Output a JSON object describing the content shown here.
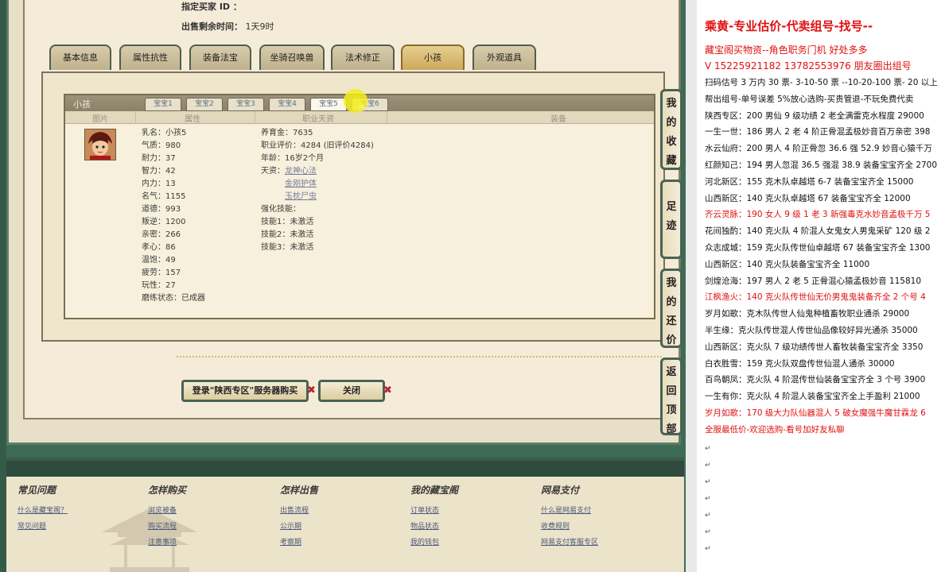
{
  "header": {
    "buyer_label": "指定买家 ID ：",
    "remaining_label": "出售剩余时间：",
    "remaining_value": "1天9时"
  },
  "tabs": [
    {
      "label": "基本信息"
    },
    {
      "label": "属性抗性"
    },
    {
      "label": "装备法宝"
    },
    {
      "label": "坐骑召唤兽"
    },
    {
      "label": "法术修正"
    },
    {
      "label": "小孩"
    },
    {
      "label": "外观道具"
    }
  ],
  "child_panel": {
    "title": "小孩",
    "baby_tabs": [
      "宝宝1",
      "宝宝2",
      "宝宝3",
      "宝宝4",
      "宝宝5",
      "宝宝6"
    ],
    "columns": [
      "图片",
      "属性",
      "职业天资",
      "装备"
    ],
    "attrs": [
      "乳名：小孩5",
      "气质：980",
      "耐力：37",
      "智力：42",
      "内力：13",
      "名气：1155",
      "道德：993",
      "叛逆：1200",
      "亲密：266",
      "孝心：86",
      "温饱：49",
      "疲劳：157",
      "玩性：27",
      "磨练状态：已成器"
    ],
    "career": {
      "line1": "养育金：7635",
      "line2": "职业评价：4284 (旧评价4284)",
      "line3": "年龄：16岁2个月",
      "talent_label": "天资：",
      "talents": [
        "龙神心法",
        "金刚护体",
        "玉枕尸虫"
      ],
      "skill_label": "强化技能：",
      "skills": [
        "技能1：未激活",
        "技能2：未激活",
        "技能3：未激活"
      ]
    }
  },
  "buttons": {
    "login": "登录\"陕西专区\"服务器购买",
    "close": "关闭"
  },
  "side_buttons": [
    "我的收藏",
    "足迹",
    "我的还价",
    "返回顶部"
  ],
  "footer": {
    "columns": [
      {
        "title": "常见问题",
        "links": [
          "什么是藏宝阁？",
          "常见问题"
        ]
      },
      {
        "title": "怎样购买",
        "links": [
          "浏览被备",
          "购买流程",
          "注意事项"
        ]
      },
      {
        "title": "怎样出售",
        "links": [
          "出售流程",
          "公示期",
          "考察期"
        ]
      },
      {
        "title": "我的藏宝阁",
        "links": [
          "订单状态",
          "物品状态",
          "我的钱包"
        ]
      },
      {
        "title": "网易支付",
        "links": [
          "什么是网易支付",
          "收费规则",
          "网易支付客服专区"
        ]
      }
    ]
  },
  "right_doc": {
    "title": "乘黄-专业估价-代卖组号-找号--",
    "lines": [
      {
        "text": "藏宝阁买物资--角色职务门机 好处多多",
        "red": true
      },
      {
        "text": "V 15225921182    13782553976 朋友圈出组号",
        "red": true
      },
      {
        "text": "扫码估号 3 万内 30 票- 3-10-50 票  --10-20-100 票- 20 以上",
        "red": false
      },
      {
        "text": "帮出组号-单号误差 5%放心选购-买贵管退-不玩免费代卖",
        "red": false
      },
      {
        "text": "陕西专区：200 男仙 9 级功绩 2 老全满雷克水程度 29000",
        "red": false
      },
      {
        "text": "一生一世：186 男人 2 老 4 阶正骨混孟极妙音百万亲密 398",
        "red": false
      },
      {
        "text": "水云仙府：200 男人 4 阶正骨忽 36.6 强 52.9 妙音心猿千万",
        "red": false
      },
      {
        "text": "红颜知己：194 男人忽混 36.5 强混 38.9 装备宝宝齐全 2700",
        "red": false
      },
      {
        "text": "河北新区：155 克木队卓越塔 6-7 装备宝宝齐全 15000",
        "red": false
      },
      {
        "text": "山西新区：140 克火队卓越塔 67 装备宝宝齐全 12000",
        "red": false
      },
      {
        "text": "齐云灵脉：190 女人 9 级 1 老 3 新强毒克水妙音孟极千万 5",
        "red": true
      },
      {
        "text": "花间独酌：140 克火队 4 阶混人女鬼女人男鬼采矿 120 级 2",
        "red": false
      },
      {
        "text": "众志成城：159 克火队传世仙卓越塔 67 装备宝宝齐全 1300",
        "red": false
      },
      {
        "text": "山西新区：140 克火队装备宝宝齐全 11000",
        "red": false
      },
      {
        "text": "剑煌沧海：197 男人 2 老 5 正骨混心猿孟极妙音 115810",
        "red": false
      },
      {
        "text": "江枫渔火：140 克火队传世仙无价男鬼鬼装备齐全 2 个号 4",
        "red": true
      },
      {
        "text": "岁月如歌：克木队传世人仙鬼种植畜牧职业通杀 29000",
        "red": false
      },
      {
        "text": "半生缘：克火队传世混人传世仙品像较好异光通杀 35000",
        "red": false
      },
      {
        "text": "山西新区：克火队 7 级功绩传世人畜牧装备宝宝齐全 3350",
        "red": false
      },
      {
        "text": "白衣胜雪：159 克火队双盘传世仙混人通杀 30000",
        "red": false
      },
      {
        "text": "百鸟朝凤：克火队 4 阶混传世仙装备宝宝齐全 3 个号 3900",
        "red": false
      },
      {
        "text": "一生有你：克火队 4 阶混人装备宝宝齐全上手盈利 21000",
        "red": false
      },
      {
        "text": "岁月如歌：170 级大力队仙器混人 5 破女魔强牛魔甘霖龙 6",
        "red": true
      },
      {
        "text": "全服最低价-欢迎选购-看号加好友私聊",
        "red": true
      }
    ]
  }
}
